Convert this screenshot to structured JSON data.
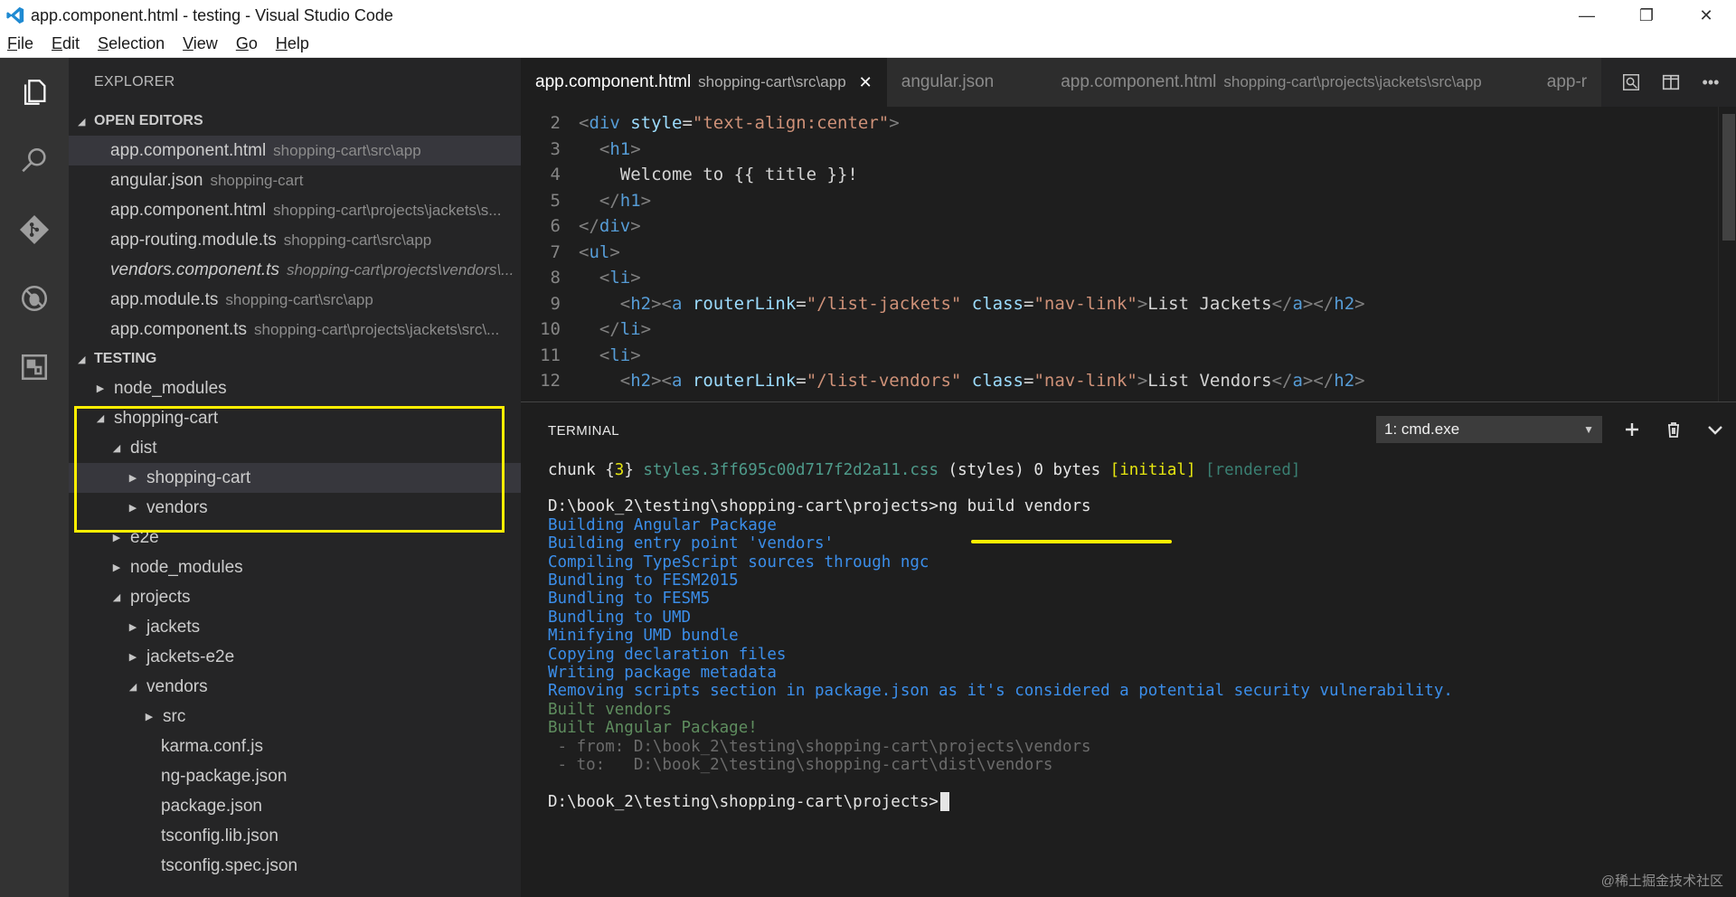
{
  "window": {
    "title": "app.component.html - testing - Visual Studio Code",
    "controls": [
      "—",
      "❐",
      "✕"
    ]
  },
  "menu": [
    {
      "label": "File",
      "key": "F",
      "rest": "ile"
    },
    {
      "label": "Edit",
      "key": "E",
      "rest": "dit"
    },
    {
      "label": "Selection",
      "key": "S",
      "rest": "election"
    },
    {
      "label": "View",
      "key": "V",
      "rest": "iew"
    },
    {
      "label": "Go",
      "key": "G",
      "rest": "o"
    },
    {
      "label": "Help",
      "key": "H",
      "rest": "elp"
    }
  ],
  "activity": [
    "files-icon",
    "search-icon",
    "source-control-icon",
    "debug-icon",
    "extensions-icon"
  ],
  "sidebar": {
    "title": "EXPLORER",
    "open_editors": {
      "header": "OPEN EDITORS",
      "items": [
        {
          "name": "app.component.html",
          "desc": "shopping-cart\\src\\app"
        },
        {
          "name": "angular.json",
          "desc": "shopping-cart"
        },
        {
          "name": "app.component.html",
          "desc": "shopping-cart\\projects\\jackets\\s..."
        },
        {
          "name": "app-routing.module.ts",
          "desc": "shopping-cart\\src\\app"
        },
        {
          "name": "vendors.component.ts",
          "desc": "shopping-cart\\projects\\vendors\\..."
        },
        {
          "name": "app.module.ts",
          "desc": "shopping-cart\\src\\app"
        },
        {
          "name": "app.component.ts",
          "desc": "shopping-cart\\projects\\jackets\\src\\..."
        }
      ]
    },
    "workspace": {
      "header": "TESTING",
      "tree": [
        {
          "label": "node_modules"
        },
        {
          "label": "shopping-cart"
        },
        {
          "label": "dist"
        },
        {
          "label": "shopping-cart"
        },
        {
          "label": "vendors"
        },
        {
          "label": "e2e"
        },
        {
          "label": "node_modules"
        },
        {
          "label": "projects"
        },
        {
          "label": "jackets"
        },
        {
          "label": "jackets-e2e"
        },
        {
          "label": "vendors"
        },
        {
          "label": "src"
        },
        {
          "label": "karma.conf.js"
        },
        {
          "label": "ng-package.json"
        },
        {
          "label": "package.json"
        },
        {
          "label": "tsconfig.lib.json"
        },
        {
          "label": "tsconfig.spec.json"
        }
      ]
    }
  },
  "tabs": [
    {
      "name": "app.component.html",
      "desc": "shopping-cart\\src\\app"
    },
    {
      "name": "angular.json",
      "desc": ""
    },
    {
      "name": "app.component.html",
      "desc": "shopping-cart\\projects\\jackets\\src\\app"
    },
    {
      "name": "app-r",
      "desc": ""
    }
  ],
  "editor": {
    "lines": [
      {
        "n": "2",
        "parts": [
          [
            "tk-br",
            "<"
          ],
          [
            "tk-tag",
            "div"
          ],
          [
            "tk-txt",
            " "
          ],
          [
            "tk-attr",
            "style"
          ],
          [
            "tk-txt",
            "="
          ],
          [
            "tk-str",
            "\"text-align:center\""
          ],
          [
            "tk-br",
            ">"
          ]
        ],
        "indent": ""
      },
      {
        "n": "3",
        "parts": [
          [
            "tk-br",
            "<"
          ],
          [
            "tk-tag",
            "h1"
          ],
          [
            "tk-br",
            ">"
          ]
        ],
        "indent": "  "
      },
      {
        "n": "4",
        "parts": [
          [
            "tk-txt",
            "Welcome to {{ title }}!"
          ]
        ],
        "indent": "    "
      },
      {
        "n": "5",
        "parts": [
          [
            "tk-br",
            "</"
          ],
          [
            "tk-tag",
            "h1"
          ],
          [
            "tk-br",
            ">"
          ]
        ],
        "indent": "  "
      },
      {
        "n": "6",
        "parts": [
          [
            "tk-br",
            "</"
          ],
          [
            "tk-tag",
            "div"
          ],
          [
            "tk-br",
            ">"
          ]
        ],
        "indent": ""
      },
      {
        "n": "7",
        "parts": [
          [
            "tk-br",
            "<"
          ],
          [
            "tk-tag",
            "ul"
          ],
          [
            "tk-br",
            ">"
          ]
        ],
        "indent": ""
      },
      {
        "n": "8",
        "parts": [
          [
            "tk-br",
            "<"
          ],
          [
            "tk-tag",
            "li"
          ],
          [
            "tk-br",
            ">"
          ]
        ],
        "indent": "  "
      },
      {
        "n": "9",
        "parts": [
          [
            "tk-br",
            "<"
          ],
          [
            "tk-tag",
            "h2"
          ],
          [
            "tk-br",
            "><"
          ],
          [
            "tk-tag",
            "a"
          ],
          [
            "tk-txt",
            " "
          ],
          [
            "tk-attr",
            "routerLink"
          ],
          [
            "tk-txt",
            "="
          ],
          [
            "tk-str",
            "\"/list-jackets\""
          ],
          [
            "tk-txt",
            " "
          ],
          [
            "tk-attr",
            "class"
          ],
          [
            "tk-txt",
            "="
          ],
          [
            "tk-str",
            "\"nav-link\""
          ],
          [
            "tk-br",
            ">"
          ],
          [
            "tk-txt",
            "List Jackets"
          ],
          [
            "tk-br",
            "</"
          ],
          [
            "tk-tag",
            "a"
          ],
          [
            "tk-br",
            "></"
          ],
          [
            "tk-tag",
            "h2"
          ],
          [
            "tk-br",
            ">"
          ]
        ],
        "indent": "    "
      },
      {
        "n": "10",
        "parts": [
          [
            "tk-br",
            "</"
          ],
          [
            "tk-tag",
            "li"
          ],
          [
            "tk-br",
            ">"
          ]
        ],
        "indent": "  "
      },
      {
        "n": "11",
        "parts": [
          [
            "tk-br",
            "<"
          ],
          [
            "tk-tag",
            "li"
          ],
          [
            "tk-br",
            ">"
          ]
        ],
        "indent": "  "
      },
      {
        "n": "12",
        "parts": [
          [
            "tk-br",
            "<"
          ],
          [
            "tk-tag",
            "h2"
          ],
          [
            "tk-br",
            "><"
          ],
          [
            "tk-tag",
            "a"
          ],
          [
            "tk-txt",
            " "
          ],
          [
            "tk-attr",
            "routerLink"
          ],
          [
            "tk-txt",
            "="
          ],
          [
            "tk-str",
            "\"/list-vendors\""
          ],
          [
            "tk-txt",
            " "
          ],
          [
            "tk-attr",
            "class"
          ],
          [
            "tk-txt",
            "="
          ],
          [
            "tk-str",
            "\"nav-link\""
          ],
          [
            "tk-br",
            ">"
          ],
          [
            "tk-txt",
            "List Vendors"
          ],
          [
            "tk-br",
            "</"
          ],
          [
            "tk-tag",
            "a"
          ],
          [
            "tk-br",
            "></"
          ],
          [
            "tk-tag",
            "h2"
          ],
          [
            "tk-br",
            ">"
          ]
        ],
        "indent": "    "
      }
    ]
  },
  "panel": {
    "title": "TERMINAL",
    "terminal_select": "1: cmd.exe",
    "lines": [
      {
        "parts": [
          [
            "c-white",
            "chunk {"
          ],
          [
            "c-yellow",
            "3"
          ],
          [
            "c-white",
            "} "
          ],
          [
            "c-green2",
            "styles.3ff695c00d717f2d2a11.css"
          ],
          [
            "c-white",
            " (styles) 0 bytes "
          ],
          [
            "c-yellow",
            "[initial]"
          ],
          [
            "c-white",
            " "
          ],
          [
            "c-teal",
            "[rendered]"
          ]
        ]
      },
      {
        "parts": []
      },
      {
        "parts": [
          [
            "c-white",
            "D:\\book_2\\testing\\shopping-cart\\projects>ng build vendors"
          ]
        ]
      },
      {
        "parts": [
          [
            "c-blue",
            "Building Angular Package"
          ]
        ]
      },
      {
        "parts": [
          [
            "c-blue",
            "Building entry point 'vendors'"
          ]
        ]
      },
      {
        "parts": [
          [
            "c-blue",
            "Compiling TypeScript sources through ngc"
          ]
        ]
      },
      {
        "parts": [
          [
            "c-blue",
            "Bundling to FESM2015"
          ]
        ]
      },
      {
        "parts": [
          [
            "c-blue",
            "Bundling to FESM5"
          ]
        ]
      },
      {
        "parts": [
          [
            "c-blue",
            "Bundling to UMD"
          ]
        ]
      },
      {
        "parts": [
          [
            "c-blue",
            "Minifying UMD bundle"
          ]
        ]
      },
      {
        "parts": [
          [
            "c-blue",
            "Copying declaration files"
          ]
        ]
      },
      {
        "parts": [
          [
            "c-blue",
            "Writing package metadata"
          ]
        ]
      },
      {
        "parts": [
          [
            "c-blue",
            "Removing scripts section in package.json as it's considered a potential security vulnerability."
          ]
        ]
      },
      {
        "parts": [
          [
            "c-green",
            "Built vendors"
          ]
        ]
      },
      {
        "parts": [
          [
            "c-green",
            "Built Angular Package!"
          ]
        ]
      },
      {
        "parts": [
          [
            "c-gray",
            " - from: D:\\book_2\\testing\\shopping-cart\\projects\\vendors"
          ]
        ]
      },
      {
        "parts": [
          [
            "c-gray",
            " - to:   D:\\book_2\\testing\\shopping-cart\\dist\\vendors"
          ]
        ]
      },
      {
        "parts": []
      },
      {
        "parts": [
          [
            "c-white",
            "D:\\book_2\\testing\\shopping-cart\\projects>"
          ]
        ],
        "cursor": true
      }
    ]
  },
  "watermark": "@稀土掘金技术社区"
}
